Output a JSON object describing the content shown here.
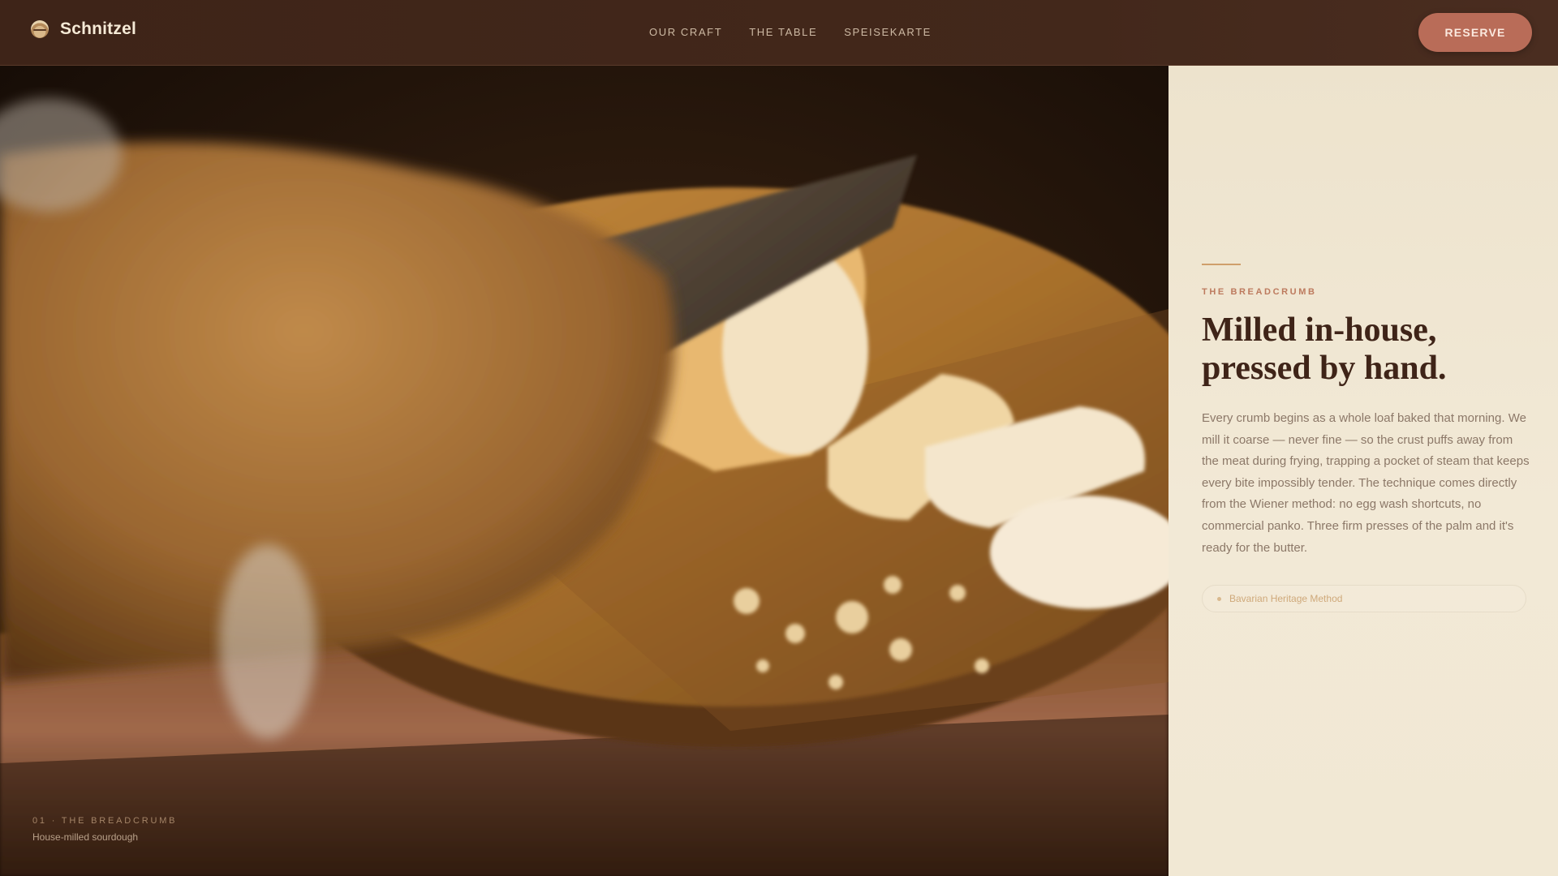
{
  "nav": {
    "brand": "Schnitzel",
    "brand_icon": "schnitzel-plate-icon",
    "links": [
      "OUR CRAFT",
      "THE TABLE",
      "SPEISEKARTE"
    ],
    "reserve_label": "RESERVE"
  },
  "hero": {
    "caption_label": "01 · THE BREADCRUMB",
    "caption_sub": "House-milled sourdough"
  },
  "panel": {
    "eyebrow": "THE BREADCRUMB",
    "headline_line1": "Milled in-house,",
    "headline_line2": "pressed by hand.",
    "body": "Every crumb begins as a whole loaf baked that morning. We mill it coarse — never fine — so the crust puffs away from the meat during frying, trapping a pocket of steam that keeps every bite impossibly tender. The technique comes directly from the Wiener method: no egg wash shortcuts, no commercial panko. Three firm presses of the palm and it's ready for the butter.",
    "tag": "Bavarian Heritage Method"
  },
  "colors": {
    "nav_bg": "#3e2418",
    "accent": "#b96c58",
    "panel_bg": "#efe6d2",
    "headline": "#3f2418"
  }
}
